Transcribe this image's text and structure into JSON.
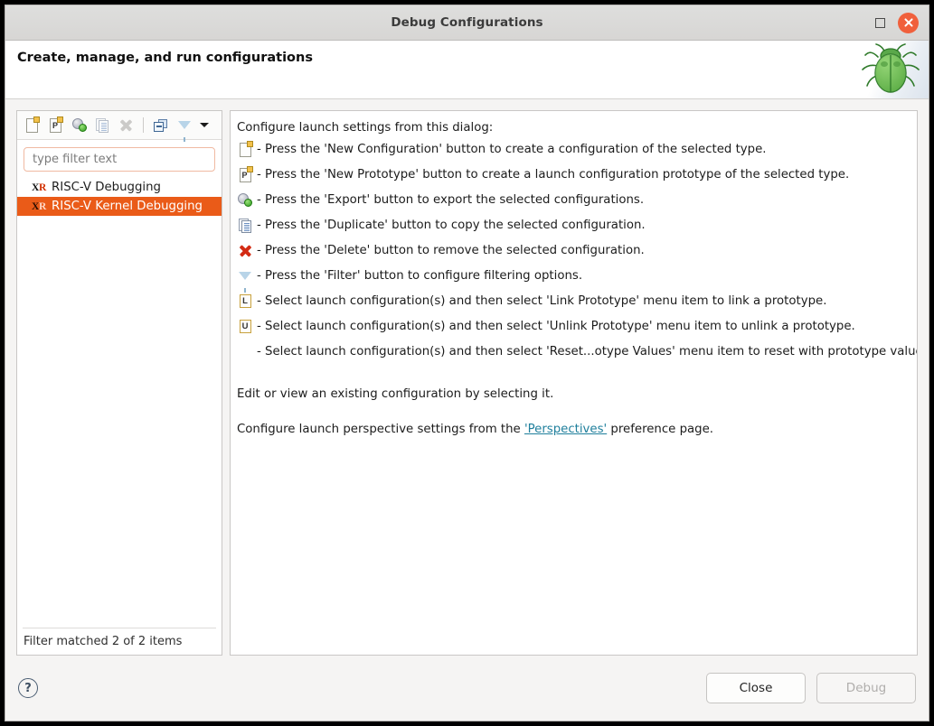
{
  "window": {
    "title": "Debug Configurations",
    "maximize_label": "maximize",
    "close_label": "close"
  },
  "header": {
    "title": "Create, manage, and run configurations",
    "icon": "bug-icon"
  },
  "toolbar": {
    "buttons": [
      {
        "name": "new-configuration-button",
        "icon": "new-configuration-icon",
        "tooltip": "New Configuration",
        "enabled": true
      },
      {
        "name": "new-prototype-button",
        "icon": "new-prototype-icon",
        "tooltip": "New Prototype",
        "enabled": true
      },
      {
        "name": "export-button",
        "icon": "export-icon",
        "tooltip": "Export",
        "enabled": true
      },
      {
        "name": "duplicate-button",
        "icon": "duplicate-icon",
        "tooltip": "Duplicate",
        "enabled": false
      },
      {
        "name": "delete-button",
        "icon": "delete-icon",
        "tooltip": "Delete",
        "enabled": false
      },
      {
        "name": "collapse-all-button",
        "icon": "collapse-all-icon",
        "tooltip": "Collapse All",
        "enabled": true
      },
      {
        "name": "filter-button",
        "icon": "filter-icon",
        "tooltip": "Filter",
        "enabled": true
      },
      {
        "name": "view-menu-button",
        "icon": "chevron-down-icon",
        "tooltip": "View Menu",
        "enabled": true
      }
    ]
  },
  "filter": {
    "placeholder": "type filter text",
    "value": "",
    "status": "Filter matched 2 of 2 items"
  },
  "tree": {
    "items": [
      {
        "label": "RISC-V Debugging",
        "icon": "XR",
        "selected": false
      },
      {
        "label": "RISC-V Kernel Debugging",
        "icon": "XR",
        "selected": true
      }
    ]
  },
  "main": {
    "intro": "Configure launch settings from this dialog:",
    "bullets": [
      {
        "icon": "new-configuration-icon",
        "text": "- Press the 'New Configuration' button to create a configuration of the selected type."
      },
      {
        "icon": "new-prototype-icon",
        "text": "- Press the 'New Prototype' button to create a launch configuration prototype of the selected type."
      },
      {
        "icon": "export-icon",
        "text": "- Press the 'Export' button to export the selected configurations."
      },
      {
        "icon": "duplicate-icon",
        "text": "- Press the 'Duplicate' button to copy the selected configuration."
      },
      {
        "icon": "delete-icon",
        "text": "- Press the 'Delete' button to remove the selected configuration."
      },
      {
        "icon": "filter-icon",
        "text": "- Press the 'Filter' button to configure filtering options."
      },
      {
        "icon": "link-prototype-icon",
        "text": "- Select launch configuration(s) and then select 'Link Prototype' menu item to link a prototype."
      },
      {
        "icon": "unlink-prototype-icon",
        "text": "- Select launch configuration(s) and then select 'Unlink Prototype' menu item to unlink a prototype."
      },
      {
        "icon": "none",
        "text": "- Select launch configuration(s) and then select 'Reset...otype Values' menu item to reset with prototype values."
      }
    ],
    "edit_note": "Edit or view an existing configuration by selecting it.",
    "perspective_prefix": "Configure launch perspective settings from the ",
    "perspective_link": "'Perspectives'",
    "perspective_suffix": " preference page."
  },
  "footer": {
    "help_label": "?",
    "close_label": "Close",
    "debug_label": "Debug",
    "debug_enabled": false
  },
  "colors": {
    "selection": "#ea5b18",
    "link": "#1f7f9c",
    "close_button": "#f0603c",
    "filter_border": "#f0b9a2"
  }
}
